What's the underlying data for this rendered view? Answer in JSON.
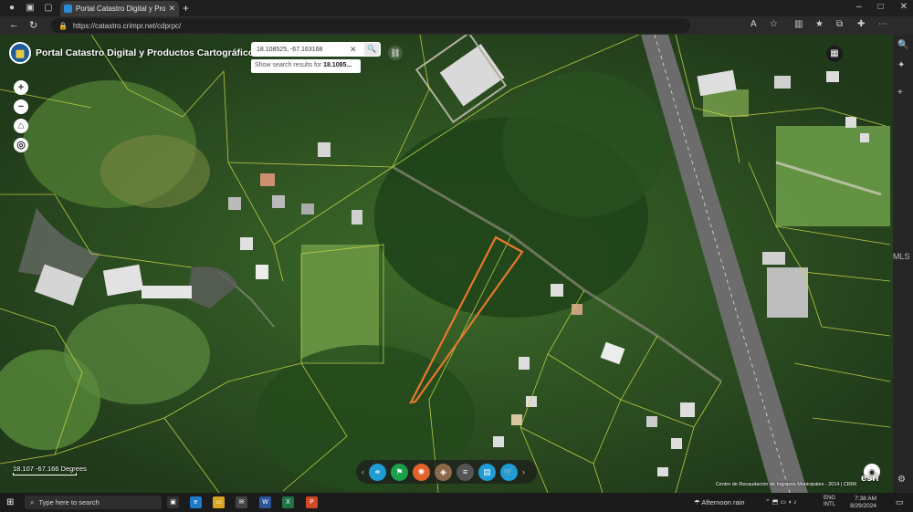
{
  "browser": {
    "tab_title": "Portal Catastro Digital y Producto",
    "url": "https://catastro.crimpr.net/cdprpc/",
    "new_tab_glyph": "+",
    "window_controls": [
      "–",
      "□",
      "✕"
    ]
  },
  "app": {
    "title": "Portal Catastro Digital y Productos Cartográficos",
    "logo_icon": "crim-logo"
  },
  "search": {
    "value": "18.108525, -67.163168",
    "suggestion_prefix": "Show search results for",
    "suggestion_bold": "18.1085..."
  },
  "map": {
    "coordinates": "18.107 -67.166 Degrees",
    "attribution": "Centro de Recaudación de Ingresos Municipales - 2014 | CRIM",
    "esri_logo": "esri",
    "highlight_color": "#e8772e",
    "parcel_line_color": "#d6e34a",
    "zoom_in": "+",
    "zoom_out": "−"
  },
  "toolbar": {
    "buttons": [
      {
        "name": "binoculars",
        "color": "#1f9bd6"
      },
      {
        "name": "flag",
        "color": "#1aa04a"
      },
      {
        "name": "measure",
        "color": "#e2622a"
      },
      {
        "name": "layers",
        "color": "#8a6a4a"
      },
      {
        "name": "list",
        "color": "#555555"
      },
      {
        "name": "print",
        "color": "#1f9bd6"
      },
      {
        "name": "cart",
        "color": "#1f9bd6"
      }
    ]
  },
  "side_label": "MLS",
  "taskbar": {
    "search_placeholder": "Type here to search",
    "weather": "Afternoon rain",
    "lang_top": "ENG",
    "lang_bottom": "INTL",
    "time": "7:38 AM",
    "date": "8/29/2024"
  }
}
